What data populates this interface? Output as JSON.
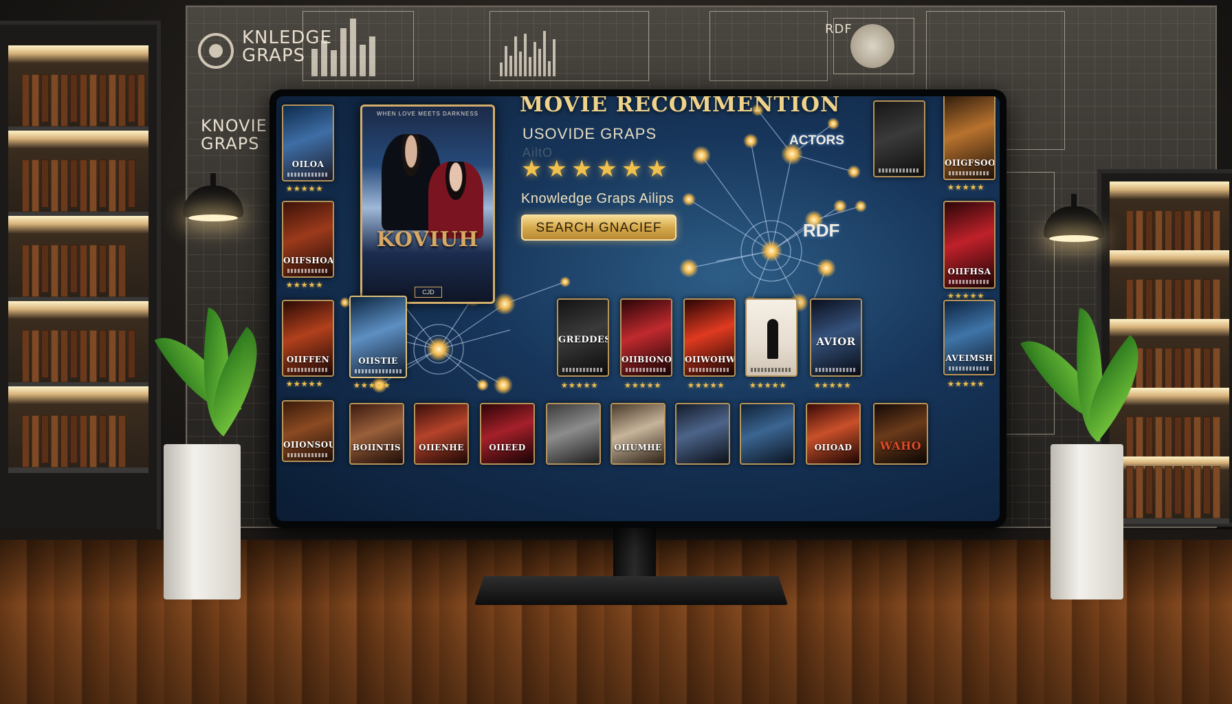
{
  "wall": {
    "logo_text": "KNLEDGE\nGRAPS",
    "side_text": "KNOVIE\nGRAPS",
    "rdf_text": "RDF"
  },
  "app": {
    "title": "MOVIE RECOMMENTION",
    "subtitle": "USOVIDE GRAPS",
    "faint_text": "AiltO",
    "rating": "★★★★★★",
    "kg_line": "Knowledge Graps Ailips",
    "search_button": "SEARCH GNACIEF",
    "actors_label": "ACTORS",
    "rdf_label": "RDF"
  },
  "featured": {
    "tagline": "WHEN LOVE MEETS DARKNESS",
    "title": "KOVIUH",
    "badge": "CJD"
  },
  "posters": {
    "left_column": [
      {
        "title": "OILOA",
        "stars": "★★★★★"
      },
      {
        "title": "OIIFSHOA",
        "stars": "★★★★★"
      },
      {
        "title": "OIIFFEN",
        "stars": "★★★★★"
      },
      {
        "title": "OIIONSOU",
        "stars": ""
      }
    ],
    "right_column": [
      {
        "title": "OIIGFSOOU",
        "stars": "★★★★★"
      },
      {
        "title": "OIIFHSA",
        "stars": "★★★★★"
      },
      {
        "title": "AVEIMSH",
        "stars": "★★★★★"
      }
    ],
    "row3": [
      {
        "title": "OIISTIE",
        "stars": "★★★★★"
      },
      {
        "title": "GREDDES",
        "stars": "★★★★★"
      },
      {
        "title": "OIIBIONOFDE",
        "stars": "★★★★★"
      },
      {
        "title": "OIIWOHWITE",
        "stars": "★★★★★"
      },
      {
        "title": "",
        "stars": "★★★★★"
      },
      {
        "title": "AVIOR",
        "stars": "★★★★★"
      }
    ],
    "row4": [
      {
        "title": "BOIINTIS"
      },
      {
        "title": "OIIENHE"
      },
      {
        "title": "OIIEED"
      },
      {
        "title": ""
      },
      {
        "title": "OIIUMHE"
      },
      {
        "title": ""
      },
      {
        "title": ""
      },
      {
        "title": "OIIOAD"
      },
      {
        "title": "WAHO"
      }
    ]
  }
}
